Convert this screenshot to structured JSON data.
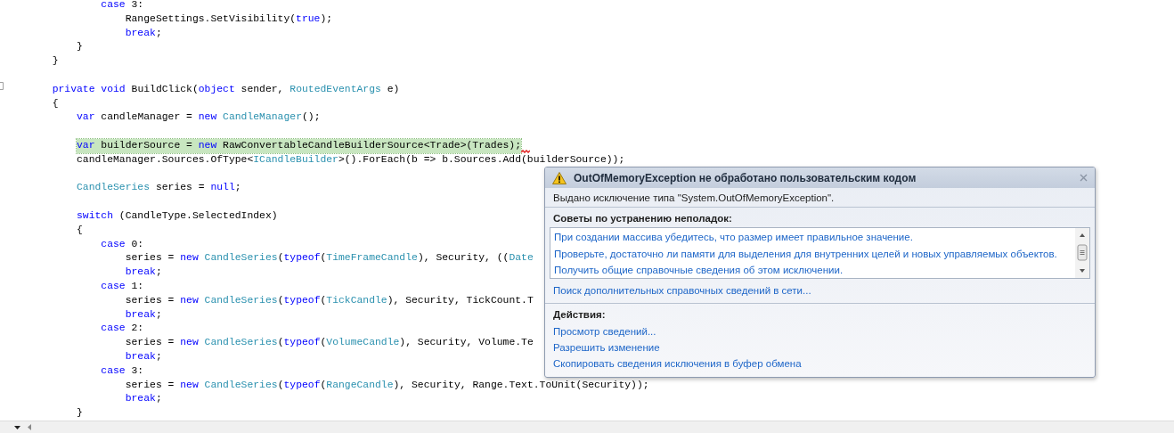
{
  "editor": {
    "lines": [
      {
        "kind": "block",
        "children": [
          {
            "kind": "block",
            "children": [
              {
                "kind": "code",
                "highlighted": false,
                "tokens": [
                  {
                    "kind": "keyword",
                    "text": "case"
                  },
                  {
                    "kind": "plain",
                    "text": " 3:"
                  }
                ],
                "children": [
                  {
                    "kind": "code",
                    "highlighted": false,
                    "tokens": [
                      {
                        "kind": "plain",
                        "text": "RangeSettings.SetVisibility("
                      },
                      {
                        "kind": "keyword",
                        "text": "true"
                      },
                      {
                        "kind": "plain",
                        "text": ");"
                      }
                    ]
                  },
                  {
                    "kind": "code",
                    "highlighted": false,
                    "tokens": [
                      {
                        "kind": "keyword",
                        "text": "break"
                      },
                      {
                        "kind": "plain",
                        "text": ";"
                      }
                    ]
                  }
                ]
              }
            ]
          },
          {
            "kind": "code",
            "highlighted": false,
            "tokens": [
              {
                "kind": "plain",
                "text": "}"
              }
            ]
          }
        ]
      },
      {
        "kind": "code",
        "highlighted": false,
        "tokens": [
          {
            "kind": "plain",
            "text": "}"
          }
        ]
      },
      {
        "kind": "blank"
      },
      {
        "kind": "code",
        "highlighted": false,
        "tokens": [
          {
            "kind": "keyword",
            "text": "private"
          },
          {
            "kind": "keyword",
            "text": " void"
          },
          {
            "kind": "plain",
            "text": " BuildClick("
          },
          {
            "kind": "keyword",
            "text": "object"
          },
          {
            "kind": "plain",
            "text": " sender, "
          },
          {
            "kind": "type",
            "text": "RoutedEventArgs"
          },
          {
            "kind": "plain",
            "text": " e)"
          }
        ]
      },
      {
        "kind": "code",
        "highlighted": false,
        "tokens": [
          {
            "kind": "plain",
            "text": "{"
          }
        ],
        "children": [
          {
            "kind": "code",
            "highlighted": false,
            "tokens": [
              {
                "kind": "keyword",
                "text": "var"
              },
              {
                "kind": "plain",
                "text": " candleManager = "
              },
              {
                "kind": "keyword",
                "text": "new"
              },
              {
                "kind": "type",
                "text": " CandleManager"
              },
              {
                "kind": "plain",
                "text": "();"
              }
            ]
          },
          {
            "kind": "blank"
          },
          {
            "kind": "code",
            "highlighted": true,
            "error": true,
            "tokens": [
              {
                "kind": "keyword",
                "text": "var"
              },
              {
                "kind": "plain",
                "text": " builderSource = "
              },
              {
                "kind": "keyword",
                "text": "new"
              },
              {
                "kind": "plain",
                "text": " RawConvertableCandleBuilderSource<Trade>(Trades);"
              }
            ]
          },
          {
            "kind": "code",
            "highlighted": false,
            "tokens": [
              {
                "kind": "plain",
                "text": "candleManager.Sources.OfType<"
              },
              {
                "kind": "type",
                "text": "ICandleBuilder"
              },
              {
                "kind": "plain",
                "text": ">().ForEach(b => b.Sources.Add(builderSource));"
              }
            ]
          },
          {
            "kind": "blank"
          },
          {
            "kind": "code",
            "highlighted": false,
            "tokens": [
              {
                "kind": "type",
                "text": "CandleSeries"
              },
              {
                "kind": "plain",
                "text": " series = "
              },
              {
                "kind": "keyword",
                "text": "null"
              },
              {
                "kind": "plain",
                "text": ";"
              }
            ]
          },
          {
            "kind": "blank"
          },
          {
            "kind": "code",
            "highlighted": false,
            "tokens": [
              {
                "kind": "keyword",
                "text": "switch"
              },
              {
                "kind": "plain",
                "text": " (CandleType.SelectedIndex)"
              }
            ]
          },
          {
            "kind": "code",
            "highlighted": false,
            "tokens": [
              {
                "kind": "plain",
                "text": "{"
              }
            ],
            "children": [
              {
                "kind": "code",
                "highlighted": false,
                "tokens": [
                  {
                    "kind": "keyword",
                    "text": "case"
                  },
                  {
                    "kind": "plain",
                    "text": " 0:"
                  }
                ],
                "children": [
                  {
                    "kind": "code",
                    "highlighted": false,
                    "tokens": [
                      {
                        "kind": "plain",
                        "text": "series = "
                      },
                      {
                        "kind": "keyword",
                        "text": "new"
                      },
                      {
                        "kind": "type",
                        "text": " CandleSeries"
                      },
                      {
                        "kind": "plain",
                        "text": "("
                      },
                      {
                        "kind": "keyword",
                        "text": "typeof"
                      },
                      {
                        "kind": "plain",
                        "text": "("
                      },
                      {
                        "kind": "type",
                        "text": "TimeFrameCandle"
                      },
                      {
                        "kind": "plain",
                        "text": "), Security, (("
                      },
                      {
                        "kind": "type",
                        "text": "Date"
                      }
                    ]
                  },
                  {
                    "kind": "code",
                    "highlighted": false,
                    "tokens": [
                      {
                        "kind": "keyword",
                        "text": "break"
                      },
                      {
                        "kind": "plain",
                        "text": ";"
                      }
                    ]
                  }
                ]
              },
              {
                "kind": "code",
                "highlighted": false,
                "tokens": [
                  {
                    "kind": "keyword",
                    "text": "case"
                  },
                  {
                    "kind": "plain",
                    "text": " 1:"
                  }
                ],
                "children": [
                  {
                    "kind": "code",
                    "highlighted": false,
                    "tokens": [
                      {
                        "kind": "plain",
                        "text": "series = "
                      },
                      {
                        "kind": "keyword",
                        "text": "new"
                      },
                      {
                        "kind": "type",
                        "text": " CandleSeries"
                      },
                      {
                        "kind": "plain",
                        "text": "("
                      },
                      {
                        "kind": "keyword",
                        "text": "typeof"
                      },
                      {
                        "kind": "plain",
                        "text": "("
                      },
                      {
                        "kind": "type",
                        "text": "TickCandle"
                      },
                      {
                        "kind": "plain",
                        "text": "), Security, TickCount.T"
                      }
                    ]
                  },
                  {
                    "kind": "code",
                    "highlighted": false,
                    "tokens": [
                      {
                        "kind": "keyword",
                        "text": "break"
                      },
                      {
                        "kind": "plain",
                        "text": ";"
                      }
                    ]
                  }
                ]
              },
              {
                "kind": "code",
                "highlighted": false,
                "tokens": [
                  {
                    "kind": "keyword",
                    "text": "case"
                  },
                  {
                    "kind": "plain",
                    "text": " 2:"
                  }
                ],
                "children": [
                  {
                    "kind": "code",
                    "highlighted": false,
                    "tokens": [
                      {
                        "kind": "plain",
                        "text": "series = "
                      },
                      {
                        "kind": "keyword",
                        "text": "new"
                      },
                      {
                        "kind": "type",
                        "text": " CandleSeries"
                      },
                      {
                        "kind": "plain",
                        "text": "("
                      },
                      {
                        "kind": "keyword",
                        "text": "typeof"
                      },
                      {
                        "kind": "plain",
                        "text": "("
                      },
                      {
                        "kind": "type",
                        "text": "VolumeCandle"
                      },
                      {
                        "kind": "plain",
                        "text": "), Security, Volume.Te"
                      }
                    ]
                  },
                  {
                    "kind": "code",
                    "highlighted": false,
                    "tokens": [
                      {
                        "kind": "keyword",
                        "text": "break"
                      },
                      {
                        "kind": "plain",
                        "text": ";"
                      }
                    ]
                  }
                ]
              },
              {
                "kind": "code",
                "highlighted": false,
                "tokens": [
                  {
                    "kind": "keyword",
                    "text": "case"
                  },
                  {
                    "kind": "plain",
                    "text": " 3:"
                  }
                ],
                "children": [
                  {
                    "kind": "code",
                    "highlighted": false,
                    "tokens": [
                      {
                        "kind": "plain",
                        "text": "series = "
                      },
                      {
                        "kind": "keyword",
                        "text": "new"
                      },
                      {
                        "kind": "type",
                        "text": " CandleSeries"
                      },
                      {
                        "kind": "plain",
                        "text": "("
                      },
                      {
                        "kind": "keyword",
                        "text": "typeof"
                      },
                      {
                        "kind": "plain",
                        "text": "("
                      },
                      {
                        "kind": "type",
                        "text": "RangeCandle"
                      },
                      {
                        "kind": "plain",
                        "text": "), Security, Range.Text.ToUnit(Security));"
                      }
                    ]
                  },
                  {
                    "kind": "code",
                    "highlighted": false,
                    "tokens": [
                      {
                        "kind": "keyword",
                        "text": "break"
                      },
                      {
                        "kind": "plain",
                        "text": ";"
                      }
                    ]
                  }
                ]
              }
            ]
          },
          {
            "kind": "code",
            "highlighted": false,
            "tokens": [
              {
                "kind": "plain",
                "text": "}"
              }
            ]
          }
        ]
      }
    ]
  },
  "exception_popup": {
    "title": "OutOfMemoryException не обработано пользовательским кодом",
    "message": "Выдано исключение типа \"System.OutOfMemoryException\".",
    "troubleshooting_heading": "Советы по устранению неполадок:",
    "tips": [
      "При создании массива убедитесь, что размер имеет правильное значение.",
      "Проверьте, достаточно ли памяти для выделения для внутренних целей и новых управляемых объектов.",
      "Получить общие справочные сведения об этом исключении."
    ],
    "search_link": "Поиск дополнительных справочных сведений в сети...",
    "actions_heading": "Действия:",
    "actions": [
      "Просмотр сведений...",
      "Разрешить изменение",
      "Скопировать сведения исключения в буфер обмена"
    ]
  }
}
